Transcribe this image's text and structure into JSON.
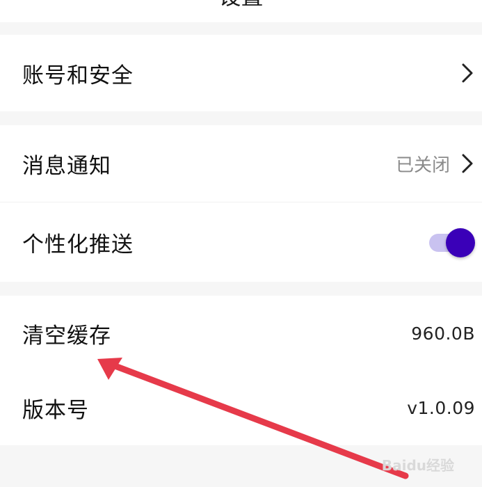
{
  "header": {
    "title": "设置"
  },
  "settings": {
    "account_security": {
      "label": "账号和安全"
    },
    "notifications": {
      "label": "消息通知",
      "value": "已关闭"
    },
    "personalized_push": {
      "label": "个性化推送",
      "enabled": true
    },
    "clear_cache": {
      "label": "清空缓存",
      "value": "960.0B"
    },
    "version": {
      "label": "版本号",
      "value": "v1.0.09"
    }
  },
  "annotation": {
    "arrow_color": "#e63a4a"
  },
  "watermark": {
    "text": "Baidu经验"
  },
  "colors": {
    "toggle_knob": "#3a00b8",
    "toggle_track": "#c9c2f0"
  }
}
